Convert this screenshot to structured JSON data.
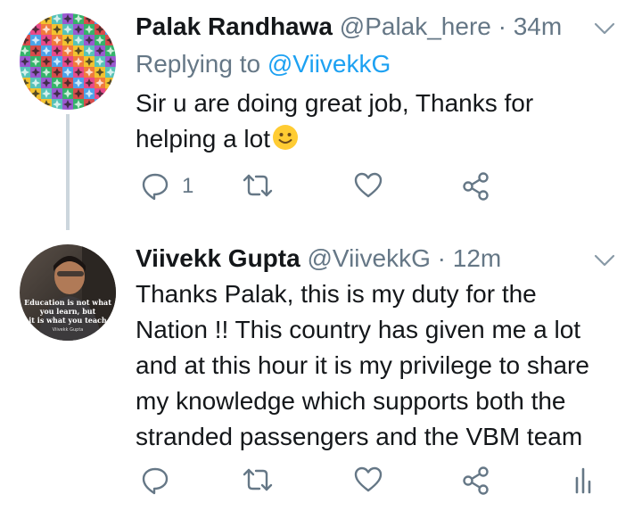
{
  "tweets": [
    {
      "name": "Palak Randhawa",
      "handle": "@Palak_here",
      "time": "· 34m",
      "replying_prefix": "Replying to",
      "replying_handle": "@ViivekkG",
      "text_line1": "Sir u are doing great job, Thanks for",
      "text_line2": "helping a lot",
      "emoji": "slightly-smiling-face",
      "reply_count": "1"
    },
    {
      "name": "Viivekk Gupta",
      "handle": "@ViivekkG",
      "time": "· 12m",
      "text_lines": [
        "Thanks Palak, this is my duty for the",
        "Nation !!  This country has given me a lot",
        "and at this hour it is my privilege to share",
        "my knowledge which supports both the",
        "stranded passengers and the VBM team"
      ],
      "avatar_caption": [
        "Education is not what",
        "you learn, but",
        "it is what you teach",
        "Viivekk Gupta"
      ]
    }
  ],
  "colors": {
    "text": "#14171a",
    "muted": "#657786",
    "link": "#1da1f2",
    "thread_line": "#ccd6dd",
    "emoji": "#ffcc33"
  }
}
